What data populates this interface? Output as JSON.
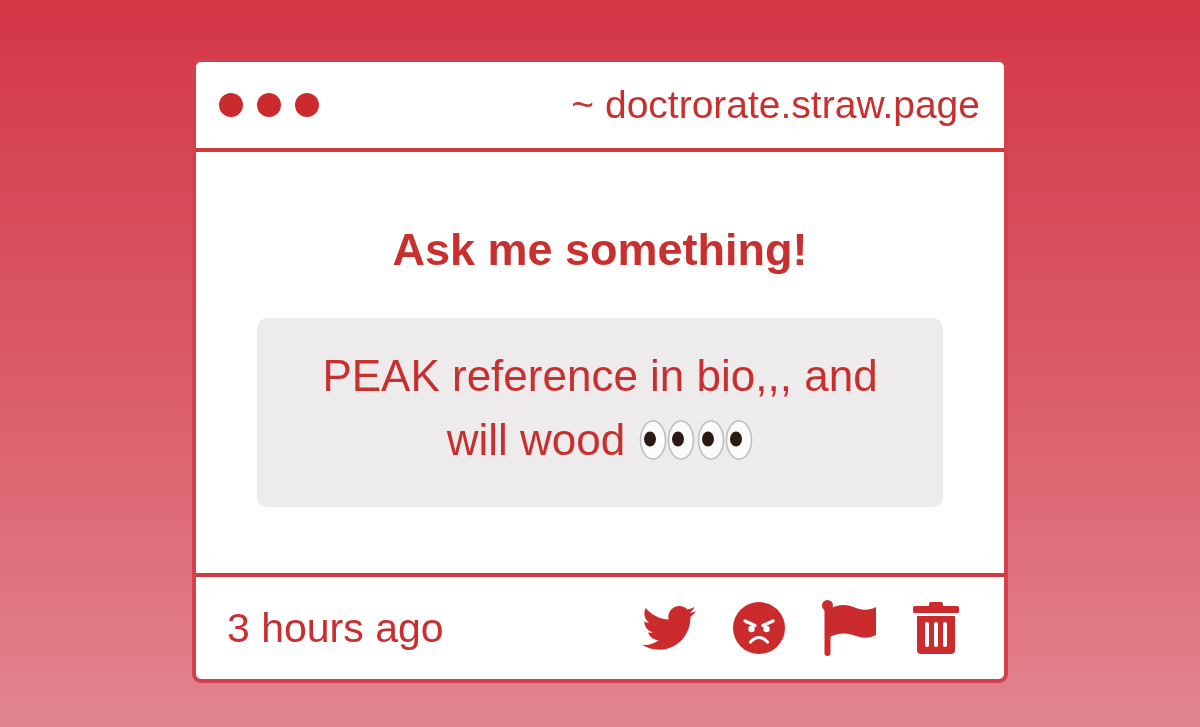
{
  "window": {
    "address": "~ doctrorate.straw.page"
  },
  "prompt": {
    "title": "Ask me something!"
  },
  "question": {
    "lines": [
      "PEAK reference in bio,,, and",
      "will wood"
    ]
  },
  "footer": {
    "time": "3 hours ago"
  }
}
